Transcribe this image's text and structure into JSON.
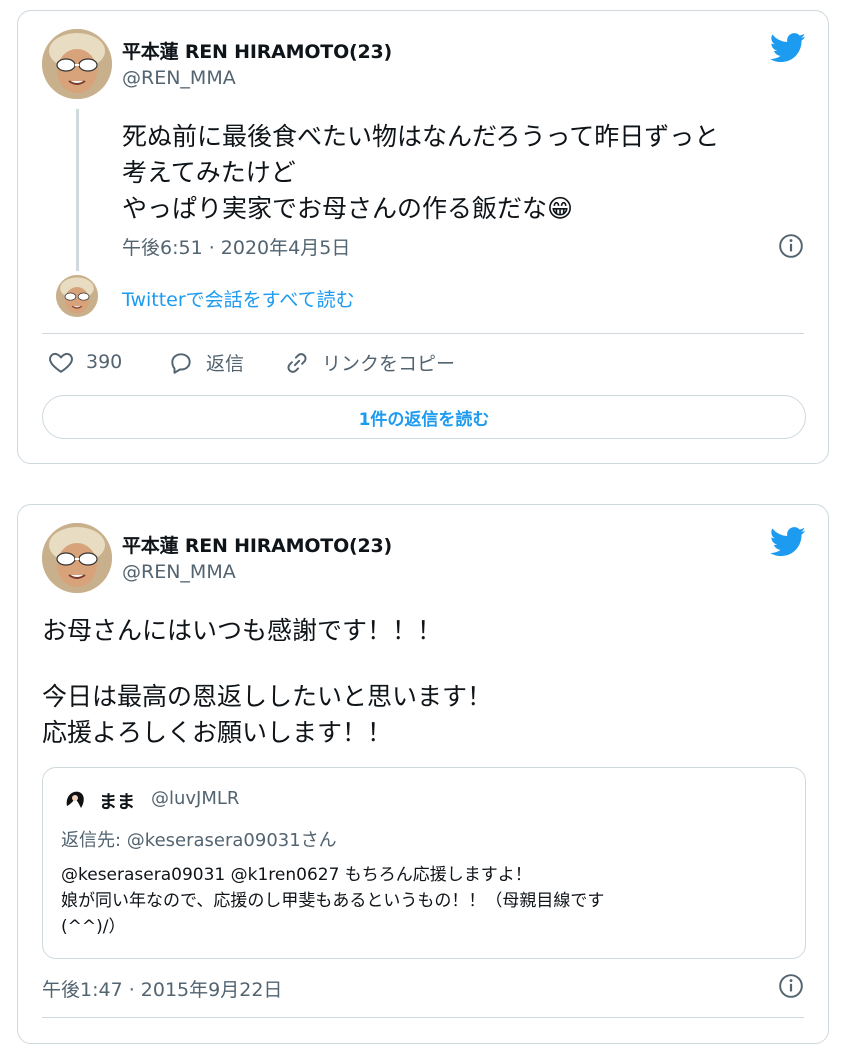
{
  "tweet1": {
    "author_name": "平本蓮 REN HIRAMOTO(23)",
    "author_handle": "@REN_MMA",
    "text_lines": [
      "死ぬ前に最後食べたい物はなんだろうって昨日ずっと",
      "考えてみたけど",
      "やっぱり実家でお母さんの作る飯だな😁"
    ],
    "timestamp": "午後6:51 · 2020年4月5日",
    "read_conversation": "Twitterで会話をすべて読む",
    "likes": "390",
    "reply_label": "返信",
    "copy_link_label": "リンクをコピー",
    "read_replies": "1件の返信を読む"
  },
  "tweet2": {
    "author_name": "平本蓮 REN HIRAMOTO(23)",
    "author_handle": "@REN_MMA",
    "text_lines": [
      "お母さんにはいつも感謝です！！！",
      "",
      "今日は最高の恩返ししたいと思います！",
      "応援よろしくお願いします！！"
    ],
    "quote": {
      "name": "まま",
      "handle": "@luvJMLR",
      "reply_to_prefix": "返信先: ",
      "reply_to_handle": "@keserasera09031さん",
      "text_lines": [
        "@keserasera09031 @k1ren0627 もちろん応援しますよ！",
        "娘が同い年なので、応援のし甲斐もあるというもの！！（母親目線です",
        "(^^)/）"
      ]
    },
    "timestamp": "午後1:47 · 2015年9月22日"
  },
  "colors": {
    "twitter_blue": "#1d9bf0",
    "text_primary": "#0f1419",
    "text_secondary": "#536471",
    "border": "#cfd9de"
  },
  "icons": [
    "twitter-bird-icon",
    "info-icon",
    "heart-icon",
    "reply-icon",
    "link-icon"
  ]
}
